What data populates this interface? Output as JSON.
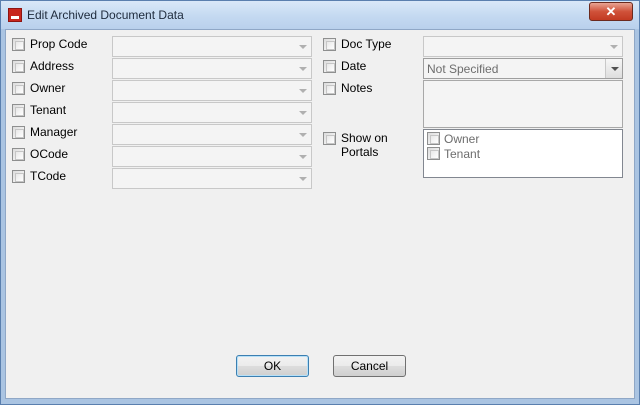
{
  "window": {
    "title": "Edit Archived Document Data",
    "close_glyph": "✕"
  },
  "left_fields": [
    {
      "label": "Prop Code",
      "value": ""
    },
    {
      "label": "Address",
      "value": ""
    },
    {
      "label": "Owner",
      "value": ""
    },
    {
      "label": "Tenant",
      "value": ""
    },
    {
      "label": "Manager",
      "value": ""
    },
    {
      "label": "OCode",
      "value": ""
    },
    {
      "label": "TCode",
      "value": ""
    }
  ],
  "right_fields": {
    "doc_type": {
      "label": "Doc Type",
      "value": ""
    },
    "date": {
      "label": "Date",
      "value": "Not Specified"
    },
    "notes": {
      "label": "Notes",
      "value": ""
    },
    "show_on_portals": {
      "label_line1": "Show on",
      "label_line2": "Portals",
      "options": [
        "Owner",
        "Tenant"
      ]
    }
  },
  "buttons": {
    "ok": "OK",
    "cancel": "Cancel"
  },
  "icons": {
    "app": "app-logo-icon",
    "dropdown": "chevron-down-icon",
    "close": "close-icon"
  }
}
